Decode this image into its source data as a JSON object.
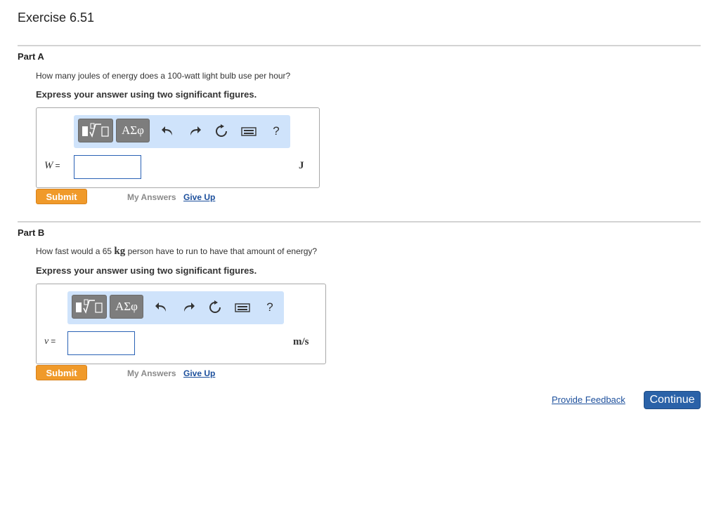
{
  "page_title": "Exercise 6.51",
  "colors": {
    "submit": "#f09a2a",
    "continue": "#2a62a8",
    "toolbar_bg": "#cfe3fb",
    "link": "#1c4f9c"
  },
  "part_a": {
    "title": "Part A",
    "question": "How many joules of energy does a 100-watt light bulb use per hour?",
    "instruction": "Express your answer using two significant figures.",
    "variable": "W",
    "equals": "=",
    "answer_value": "",
    "unit": "J",
    "toolbar": {
      "templates_icon": "templates-icon",
      "symbols_label": "ΑΣφ",
      "help_label": "?"
    },
    "submit_label": "Submit",
    "my_answers_label": "My Answers",
    "give_up_label": "Give Up"
  },
  "part_b": {
    "title": "Part B",
    "question_prefix": "How fast would a 65 ",
    "question_unit": "kg",
    "question_suffix": " person have to run to have that amount of energy?",
    "instruction": "Express your answer using two significant figures.",
    "variable": "v",
    "equals": "=",
    "answer_value": "",
    "unit": "m/s",
    "toolbar": {
      "templates_icon": "templates-icon",
      "symbols_label": "ΑΣφ",
      "help_label": "?"
    },
    "submit_label": "Submit",
    "my_answers_label": "My Answers",
    "give_up_label": "Give Up"
  },
  "footer": {
    "feedback_label": "Provide Feedback",
    "continue_label": "Continue"
  }
}
